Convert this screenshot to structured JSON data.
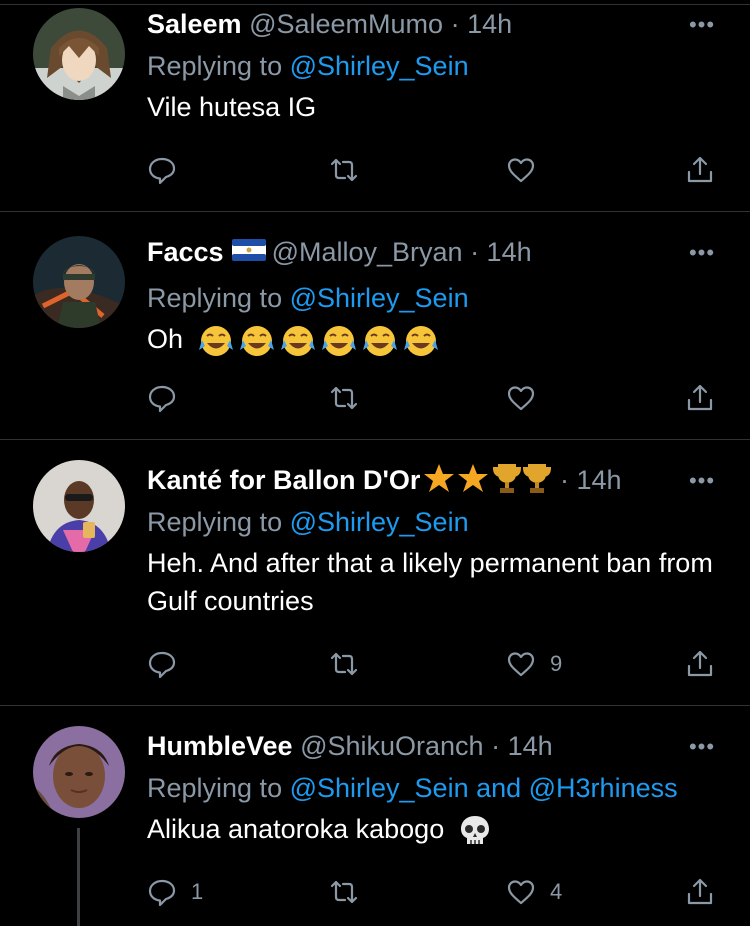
{
  "tweets": [
    {
      "name": "Saleem",
      "handle": "@SaleemMumo",
      "time": "· 14h",
      "replying_prefix": "Replying to ",
      "replying_to": "@Shirley_Sein",
      "text": "Vile hutesa IG",
      "reply_count": "",
      "like_count": "",
      "avatar_icon": "anime-character-avatar"
    },
    {
      "name": "Faccs",
      "handle": "@Malloy_Bryan",
      "time": "· 14h",
      "replying_prefix": "Replying to ",
      "replying_to": "@Shirley_Sein",
      "text": "Oh",
      "emoji": [
        "face-with-tears-of-joy",
        "face-with-tears-of-joy",
        "face-with-tears-of-joy",
        "face-with-tears-of-joy",
        "face-with-tears-of-joy",
        "face-with-tears-of-joy"
      ],
      "flag": "el-salvador-flag",
      "reply_count": "",
      "like_count": "",
      "avatar_icon": "soldier-game-avatar"
    },
    {
      "name": "Kanté for Ballon D'Or",
      "handle": "",
      "time": "· 14h",
      "replying_prefix": "Replying to ",
      "replying_to": "@Shirley_Sein",
      "text": "Heh. And after that a likely permanent ban from Gulf countries",
      "badges": [
        "star",
        "star",
        "trophy",
        "trophy"
      ],
      "reply_count": "",
      "like_count": "9",
      "avatar_icon": "person-photo-avatar"
    },
    {
      "name": "HumbleVee",
      "handle": "@ShikuOranch",
      "time": "· 14h",
      "replying_prefix": "Replying to ",
      "replying_to": "@Shirley_Sein and @H3rhiness",
      "text": "Alikua anatoroka kabogo",
      "emoji": [
        "skull"
      ],
      "reply_count": "1",
      "like_count": "4",
      "avatar_icon": "person-selfie-avatar"
    }
  ],
  "more_label": "•••",
  "colors": {
    "background": "#000000",
    "mention": "#1d9bf0",
    "muted": "#8b98a5",
    "divider": "#2f3336"
  }
}
